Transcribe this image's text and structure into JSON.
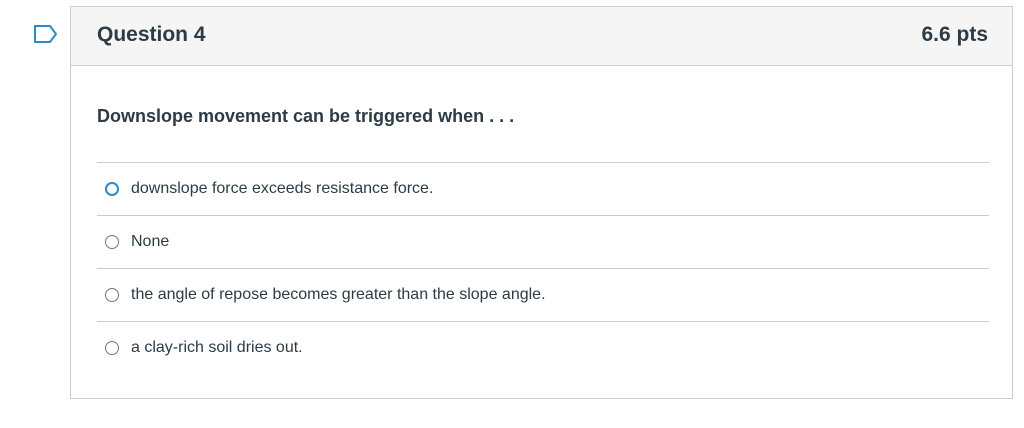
{
  "flag": {
    "icon": "flag-outline-icon",
    "color": "#2d8ac7"
  },
  "question": {
    "title": "Question 4",
    "points": "6.6 pts",
    "text": "Downslope movement can be triggered when  . . ."
  },
  "answers": [
    {
      "label": "downslope force exceeds resistance force.",
      "selected": false,
      "focused": true
    },
    {
      "label": "None",
      "selected": false,
      "focused": false
    },
    {
      "label": "the angle of repose becomes greater than the slope angle.",
      "selected": false,
      "focused": false
    },
    {
      "label": "a clay-rich soil dries out.",
      "selected": false,
      "focused": false
    }
  ]
}
